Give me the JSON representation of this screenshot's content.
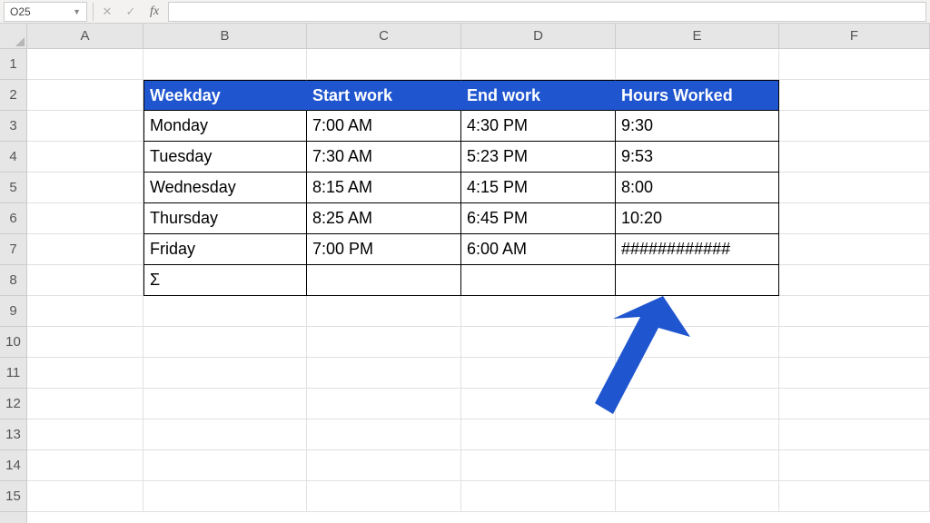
{
  "name_box": "O25",
  "column_widths": {
    "A": 128,
    "B": 180,
    "C": 170,
    "D": 170,
    "E": 180,
    "F": 166
  },
  "columns": [
    "A",
    "B",
    "C",
    "D",
    "E",
    "F"
  ],
  "rows": [
    "1",
    "2",
    "3",
    "4",
    "5",
    "6",
    "7",
    "8",
    "9",
    "10",
    "11",
    "12",
    "13",
    "14",
    "15"
  ],
  "table": {
    "header": {
      "b": "Weekday",
      "c": "Start work",
      "d": "End work",
      "e": "Hours Worked"
    },
    "rows": [
      {
        "b": "Monday",
        "c": "7:00 AM",
        "d": "4:30 PM",
        "e": "9:30"
      },
      {
        "b": "Tuesday",
        "c": "7:30 AM",
        "d": "5:23 PM",
        "e": "9:53"
      },
      {
        "b": "Wednesday",
        "c": "8:15 AM",
        "d": "4:15 PM",
        "e": "8:00"
      },
      {
        "b": "Thursday",
        "c": "8:25 AM",
        "d": "6:45 PM",
        "e": "10:20"
      },
      {
        "b": "Friday",
        "c": "7:00 PM",
        "d": "6:00 AM",
        "e": "############"
      }
    ],
    "sum_label": "Σ"
  },
  "chart_data": {
    "type": "table",
    "title": "Weekday work hours",
    "columns": [
      "Weekday",
      "Start work",
      "End work",
      "Hours Worked"
    ],
    "rows": [
      [
        "Monday",
        "7:00 AM",
        "4:30 PM",
        "9:30"
      ],
      [
        "Tuesday",
        "7:30 AM",
        "5:23 PM",
        "9:53"
      ],
      [
        "Wednesday",
        "8:15 AM",
        "4:15 PM",
        "8:00"
      ],
      [
        "Thursday",
        "8:25 AM",
        "6:45 PM",
        "10:20"
      ],
      [
        "Friday",
        "7:00 PM",
        "6:00 AM",
        "############"
      ]
    ],
    "footer": [
      "Σ",
      "",
      "",
      ""
    ]
  }
}
